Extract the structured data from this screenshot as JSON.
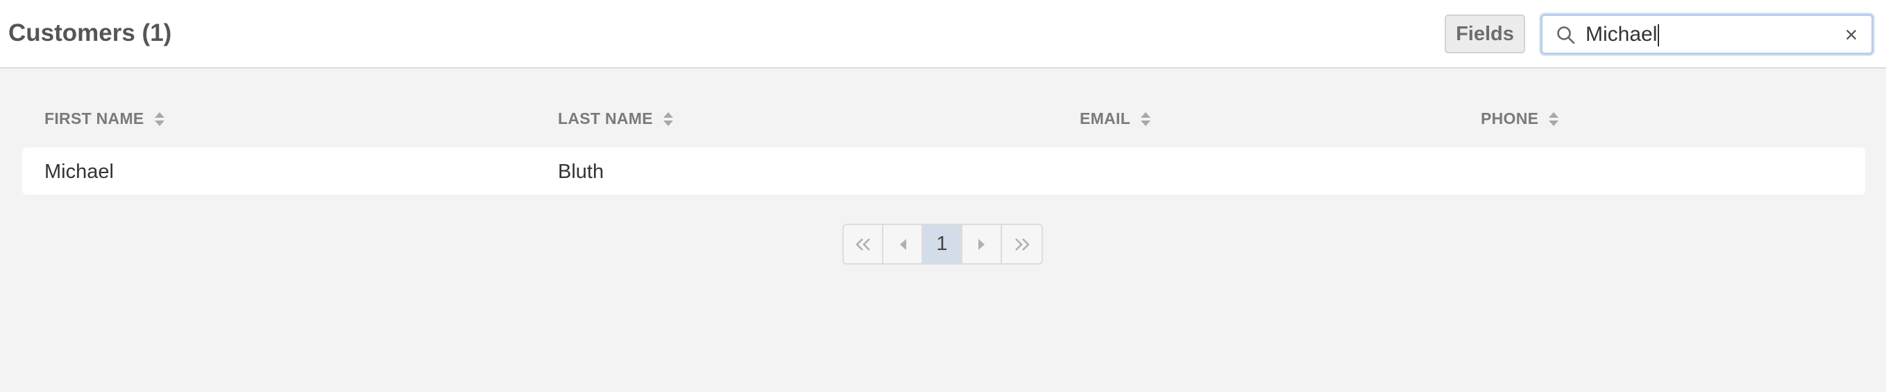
{
  "header": {
    "title": "Customers (1)",
    "fields_label": "Fields",
    "search_value": "Michael",
    "clear_icon": "×"
  },
  "table": {
    "columns": [
      "FIRST NAME",
      "LAST NAME",
      "EMAIL",
      "PHONE"
    ],
    "rows": [
      [
        "Michael",
        "Bluth",
        "",
        ""
      ]
    ]
  },
  "pagination": {
    "current_page": "1"
  },
  "icons": {
    "search": "search-icon",
    "clear": "close-icon",
    "sort": "sort-icon",
    "first": "double-chevron-left-icon",
    "prev": "caret-left-icon",
    "next": "caret-right-icon",
    "last": "double-chevron-right-icon"
  }
}
